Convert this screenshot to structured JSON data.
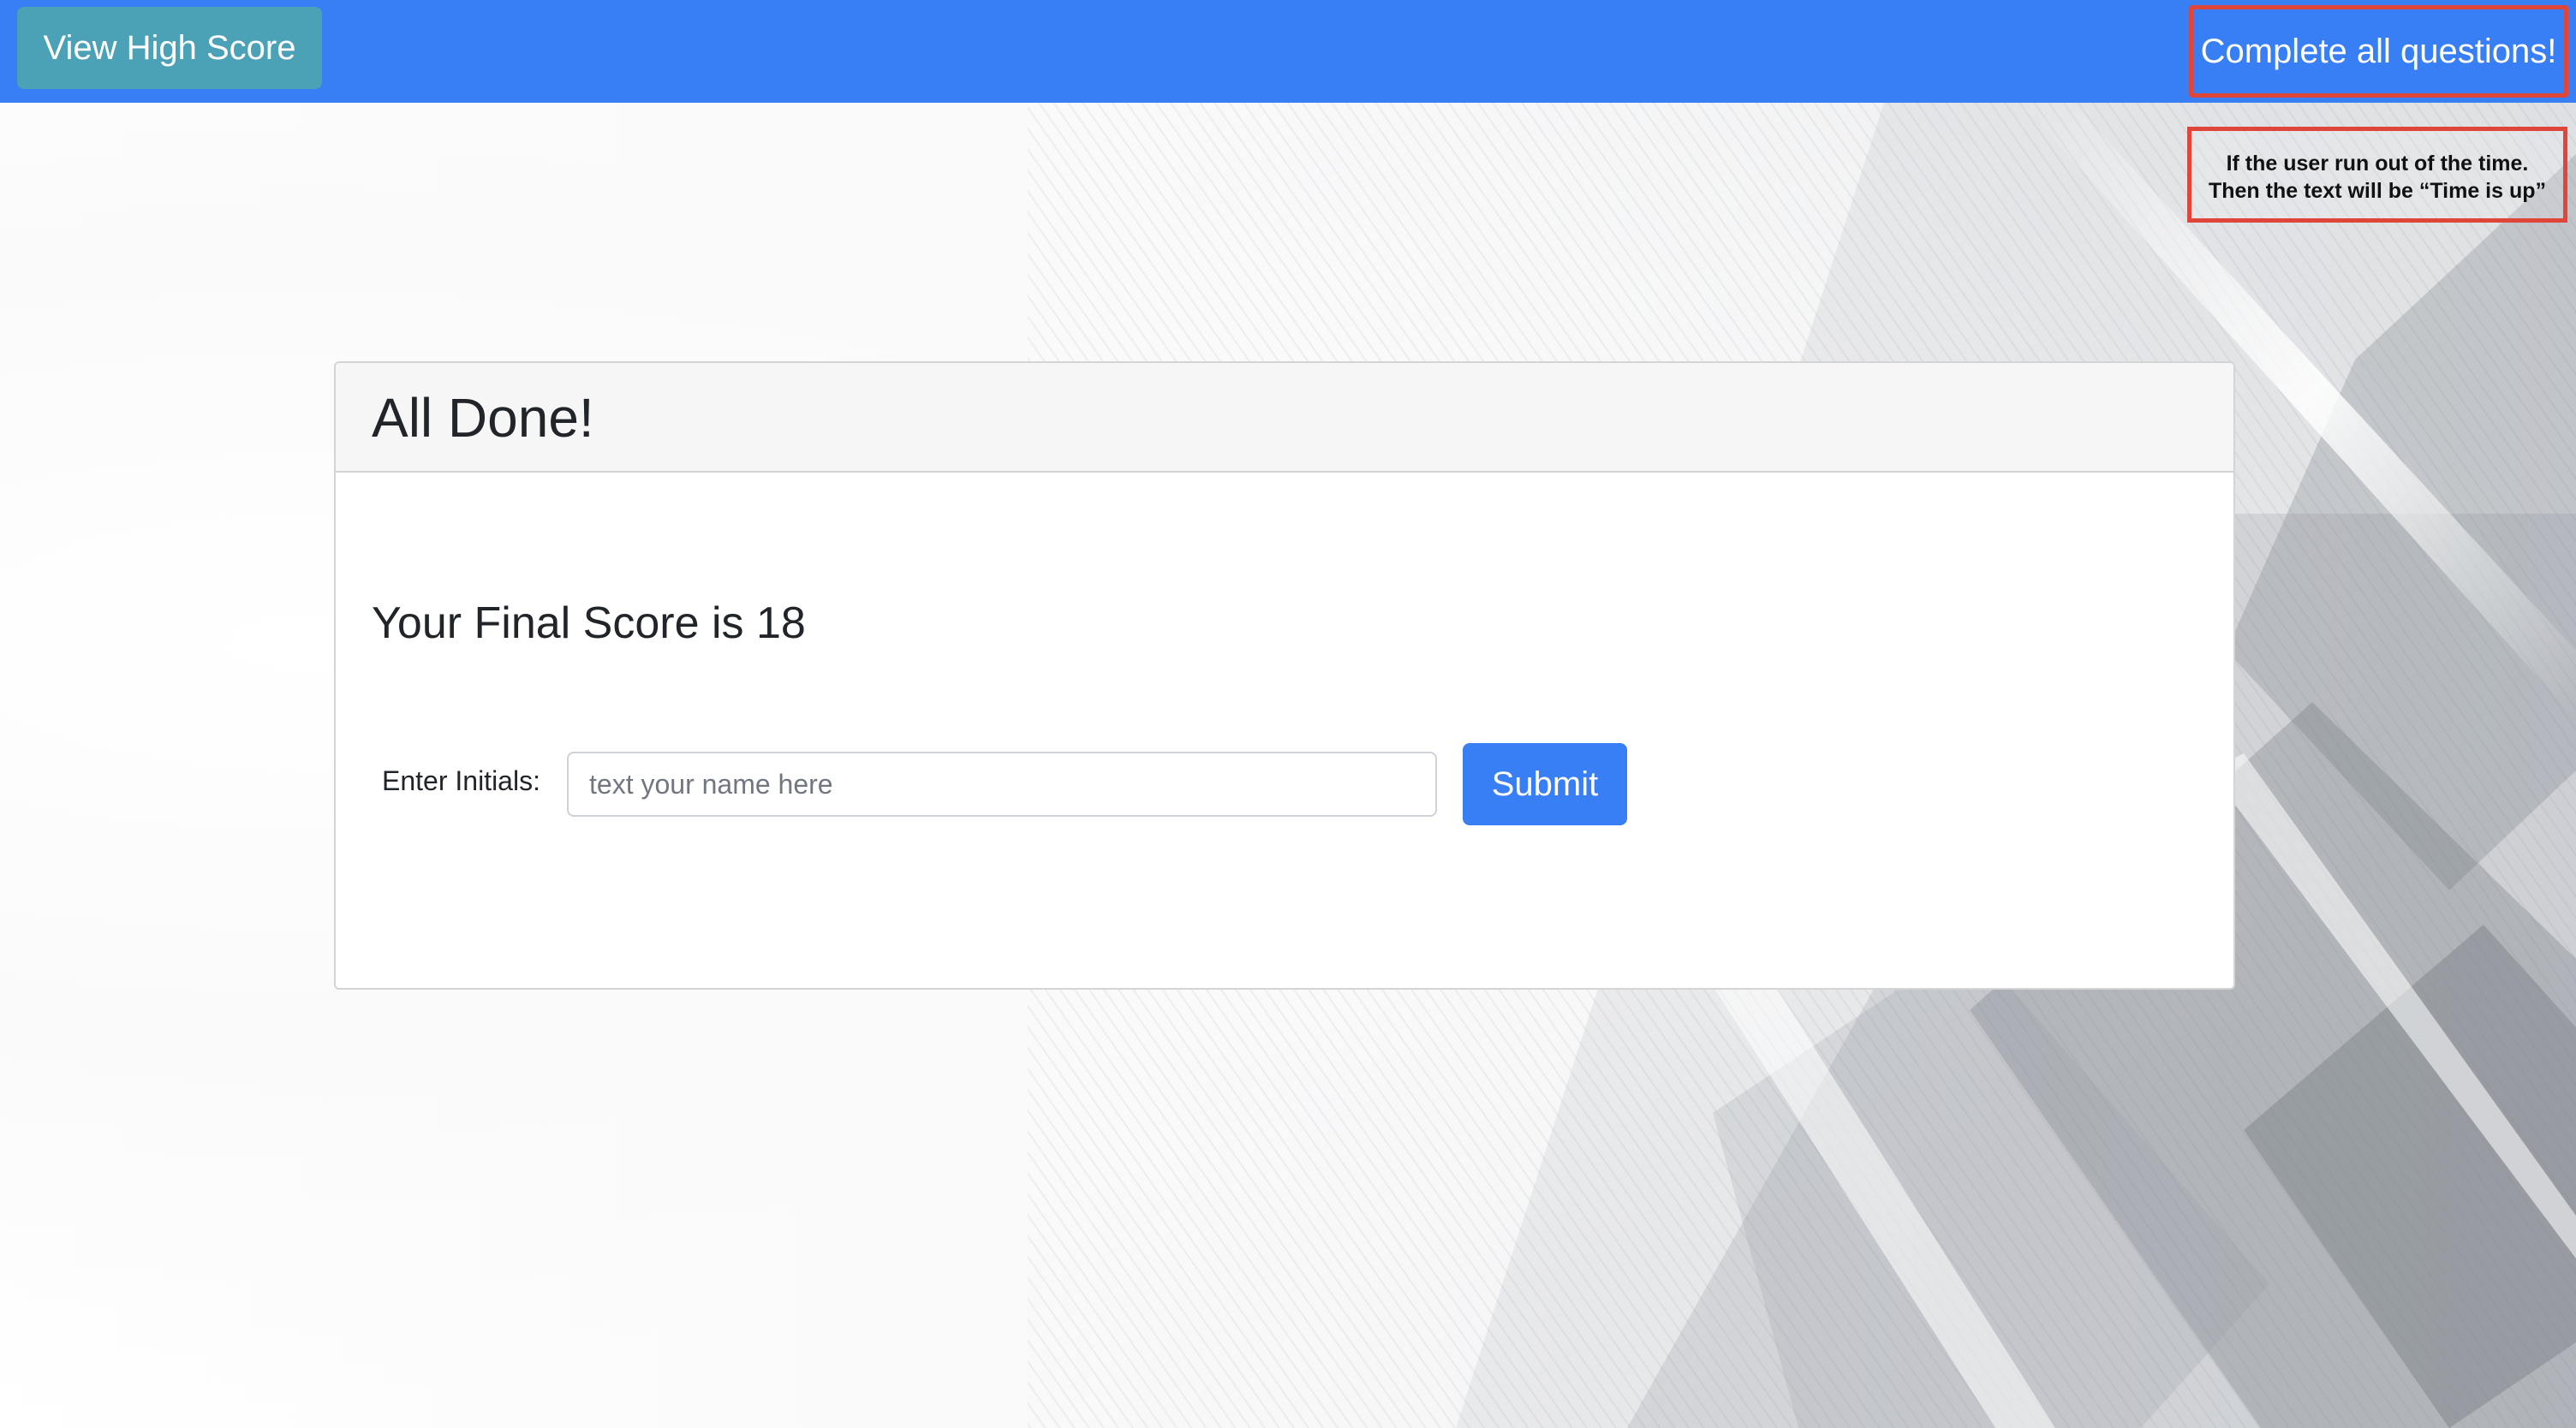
{
  "topbar": {
    "high_score_label": "View High Score",
    "status_text": "Complete all questions!",
    "color": "#387ef5",
    "high_score_color": "#4ba1b6"
  },
  "annotation": {
    "line1": "If the user run out of the time.",
    "line2": "Then the text will be “Time is up”",
    "border_color": "#e0453a"
  },
  "card": {
    "title": "All Done!",
    "score_text": "Your Final Score is 18",
    "initials_label": "Enter Initials:",
    "initials_placeholder": "text your name here",
    "initials_value": "",
    "submit_label": "Submit",
    "submit_color": "#387ef5"
  }
}
